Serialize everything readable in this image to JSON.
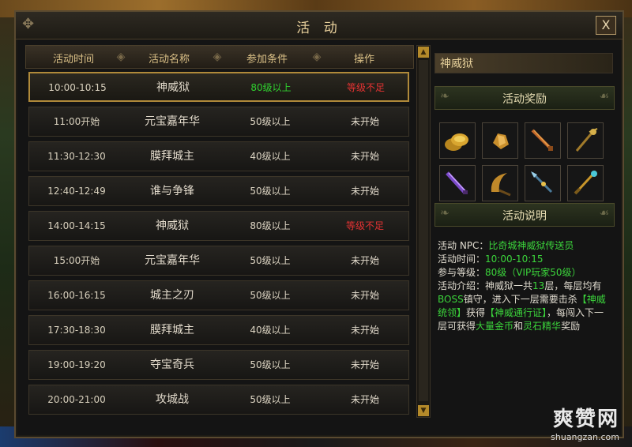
{
  "window": {
    "title": "活 动",
    "close_label": "X"
  },
  "table": {
    "headers": [
      "活动时间",
      "活动名称",
      "参加条件",
      "操作"
    ],
    "rows": [
      {
        "time": "10:00-10:15",
        "name": "神威狱",
        "req": "80级以上",
        "status": "等级不足",
        "selected": true
      },
      {
        "time": "11:00开始",
        "name": "元宝嘉年华",
        "req": "50级以上",
        "status": "未开始"
      },
      {
        "time": "11:30-12:30",
        "name": "膜拜城主",
        "req": "40级以上",
        "status": "未开始"
      },
      {
        "time": "12:40-12:49",
        "name": "谁与争锋",
        "req": "50级以上",
        "status": "未开始"
      },
      {
        "time": "14:00-14:15",
        "name": "神威狱",
        "req": "80级以上",
        "status": "等级不足"
      },
      {
        "time": "15:00开始",
        "name": "元宝嘉年华",
        "req": "50级以上",
        "status": "未开始"
      },
      {
        "time": "16:00-16:15",
        "name": "城主之刃",
        "req": "50级以上",
        "status": "未开始"
      },
      {
        "time": "17:30-18:30",
        "name": "膜拜城主",
        "req": "40级以上",
        "status": "未开始"
      },
      {
        "time": "19:00-19:20",
        "name": "夺宝奇兵",
        "req": "50级以上",
        "status": "未开始"
      },
      {
        "time": "20:00-21:00",
        "name": "攻城战",
        "req": "50级以上",
        "status": "未开始"
      }
    ]
  },
  "detail": {
    "selected_name": "神威狱",
    "rewards_title": "活动奖励",
    "desc_title": "活动说明",
    "reward_icons": [
      "gold-coins-icon",
      "gold-ore-icon",
      "sword-icon",
      "staff-icon",
      "blade-icon",
      "crescent-blade-icon",
      "spear-icon",
      "scepter-icon"
    ],
    "desc": {
      "npc_label": "活动 NPC：",
      "npc_value": "比奇城神威狱传送员",
      "time_label": "活动时间：",
      "time_value": "10:00-10:15",
      "level_label": "参与等级：",
      "level_value": "80级（VIP玩家50级）",
      "intro_label": "活动介绍：",
      "intro_1": "神威狱一共",
      "intro_2": "13",
      "intro_3": "层，每层均有",
      "intro_4": "BOSS",
      "intro_5": "镇守，进入下一层需要击杀",
      "intro_6": "【神威统领】",
      "intro_7": "获得",
      "intro_8": "【神威通行证】",
      "intro_9": "，每闯入下一层可获得",
      "intro_10": "大量金币",
      "intro_11": "和",
      "intro_12": "灵石精华",
      "intro_13": "奖励"
    }
  },
  "colors": {
    "req_ok": "#2fd02f",
    "status_warn": "#e23232",
    "desc_value": "#3bd43b"
  },
  "watermark": {
    "main": "爽赞网",
    "sub": "shuangzan.com"
  }
}
